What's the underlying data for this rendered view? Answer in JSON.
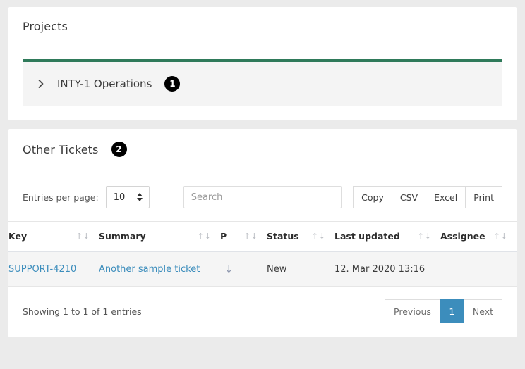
{
  "colors": {
    "page_bg": "#ebebeb",
    "card_bg": "#ffffff",
    "project_accent": "#2f7a5a",
    "link_blue": "#3c8dbc",
    "active_page_blue": "#3c8dbc",
    "badge_black": "#000000",
    "priority_arrow": "#8e97ae"
  },
  "projects_card": {
    "title": "Projects",
    "badge": "1",
    "chevron_icon": "chevron-right-icon",
    "project_name": "INTY-1 Operations"
  },
  "tickets_card": {
    "title": "Other Tickets",
    "badge": "2",
    "toolbar": {
      "entries_label": "Entries per page:",
      "entries_value": "10",
      "search_placeholder": "Search",
      "search_value": "",
      "export_buttons": [
        "Copy",
        "CSV",
        "Excel",
        "Print"
      ]
    },
    "table": {
      "sort_arrows": "↑↓",
      "columns": [
        {
          "label": "Key",
          "sortable": true
        },
        {
          "label": "Summary",
          "sortable": true
        },
        {
          "label": "P",
          "sortable": true
        },
        {
          "label": "Status",
          "sortable": true
        },
        {
          "label": "Last updated",
          "sortable": true
        },
        {
          "label": "Assignee",
          "sortable": true
        }
      ],
      "rows": [
        {
          "key": "SUPPORT-4210",
          "summary": "Another sample ticket",
          "priority_icon": "arrow-down-icon",
          "priority": "↓",
          "status": "New",
          "last_updated": "12. Mar 2020 13:16",
          "assignee": ""
        }
      ]
    },
    "footer": {
      "showing_text": "Showing 1 to 1 of 1 entries",
      "previous_label": "Previous",
      "page_label": "1",
      "next_label": "Next"
    }
  }
}
